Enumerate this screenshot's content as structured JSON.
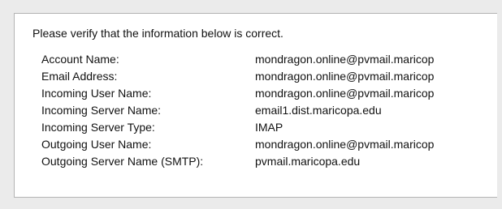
{
  "intro_text": "Please verify that the information below is correct.",
  "rows": [
    {
      "label": "Account Name:",
      "value": "mondragon.online@pvmail.maricop"
    },
    {
      "label": "Email Address:",
      "value": "mondragon.online@pvmail.maricop"
    },
    {
      "label": "Incoming User Name:",
      "value": "mondragon.online@pvmail.maricop"
    },
    {
      "label": "Incoming Server Name:",
      "value": "email1.dist.maricopa.edu"
    },
    {
      "label": "Incoming Server Type:",
      "value": "IMAP"
    },
    {
      "label": "Outgoing User Name:",
      "value": "mondragon.online@pvmail.maricop"
    },
    {
      "label": "Outgoing Server Name (SMTP):",
      "value": "pvmail.maricopa.edu"
    }
  ]
}
